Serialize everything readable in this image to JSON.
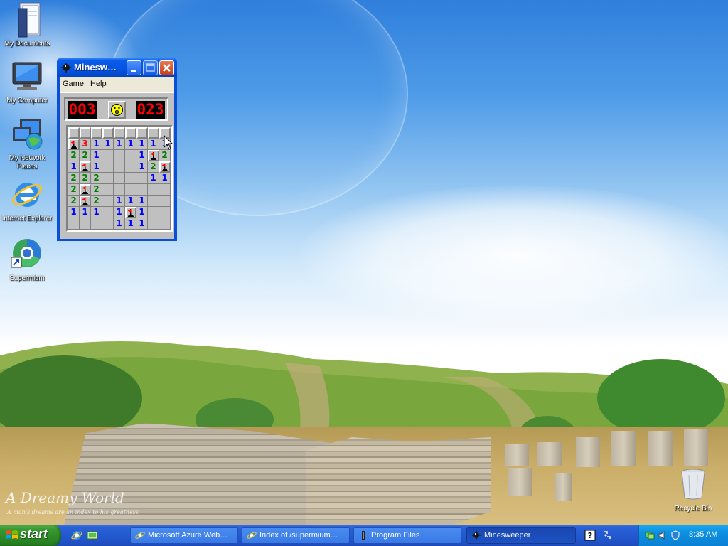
{
  "desktop": {
    "icons": [
      {
        "label": "My Documents"
      },
      {
        "label": "My Computer"
      },
      {
        "label": "My Network Places"
      },
      {
        "label": "Internet Explorer"
      },
      {
        "label": "Supermium"
      }
    ],
    "recycle_bin": "Recycle Bin",
    "wallpaper_title": "A Dreamy World",
    "wallpaper_subtitle": "A man's dreams are an index to his greatness"
  },
  "minesweeper": {
    "title": "Minesweeper",
    "title_display": "Minesw…",
    "menu": [
      "Game",
      "Help"
    ],
    "mine_counter": "003",
    "timer": "023",
    "board": [
      [
        "c",
        "c",
        "c",
        "c",
        "c",
        "c",
        "c",
        "c",
        "c"
      ],
      [
        "F",
        "3",
        "1",
        "1",
        "1",
        "1",
        "1",
        "1",
        "1"
      ],
      [
        "2",
        "2",
        "1",
        "",
        "",
        "",
        "1",
        "F",
        "2"
      ],
      [
        "1",
        "F",
        "1",
        "",
        "",
        "",
        "1",
        "2",
        "F"
      ],
      [
        "2",
        "2",
        "2",
        "",
        "",
        "",
        "",
        "1",
        "1"
      ],
      [
        "2",
        "F",
        "2",
        "",
        "",
        "",
        "",
        "",
        ""
      ],
      [
        "2",
        "F",
        "2",
        "",
        "1",
        "1",
        "1",
        "",
        ""
      ],
      [
        "1",
        "1",
        "1",
        "",
        "1",
        "F",
        "1",
        "",
        ""
      ],
      [
        "",
        "",
        "",
        "",
        "1",
        "1",
        "1",
        "",
        ""
      ]
    ]
  },
  "taskbar": {
    "start_label": "start",
    "tasks": [
      {
        "label": "Microsoft Azure Web…",
        "active": false
      },
      {
        "label": "Index of /supermium…",
        "active": false
      },
      {
        "label": "Program Files",
        "active": false
      },
      {
        "label": "Minesweeper",
        "active": true
      }
    ],
    "clock": "8:35 AM"
  },
  "colors": {
    "num_1": "#0000ff",
    "num_2": "#008000",
    "num_3": "#ff0000",
    "lcd": "#ff0000",
    "taskbar": "#245edb",
    "start": "#3a9a33"
  }
}
